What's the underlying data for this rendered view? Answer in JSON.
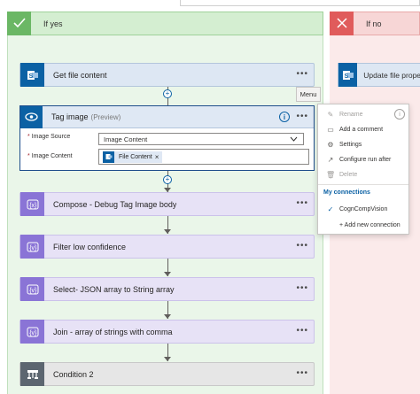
{
  "branches": {
    "yes_label": "If yes",
    "no_label": "If no"
  },
  "actions": {
    "get_file": "Get file content",
    "tag_image": "Tag image",
    "tag_preview": "(Preview)",
    "compose": "Compose - Debug Tag Image body",
    "filter": "Filter low confidence",
    "select": "Select- JSON array to String array",
    "join": "Join - array of strings with comma",
    "condition": "Condition 2",
    "update_file": "Update file properties"
  },
  "tag_fields": {
    "source_label": "Image Source",
    "source_value": "Image Content",
    "content_label": "Image Content",
    "content_token": "File Content"
  },
  "menu": {
    "tip": "Menu",
    "rename": "Rename",
    "add_comment": "Add a comment",
    "settings": "Settings",
    "configure_run_after": "Configure run after",
    "delete": "Delete",
    "my_connections": "My connections",
    "connection": "CognCompVision",
    "add_connection": "+ Add new connection"
  },
  "icons": {
    "more": "more-icon",
    "info": "info-icon"
  },
  "colors": {
    "yes_accent": "#6bb765",
    "no_accent": "#e05b5b",
    "sharepoint_blue": "#0b61a4",
    "compose_purple": "#8a74d6"
  }
}
